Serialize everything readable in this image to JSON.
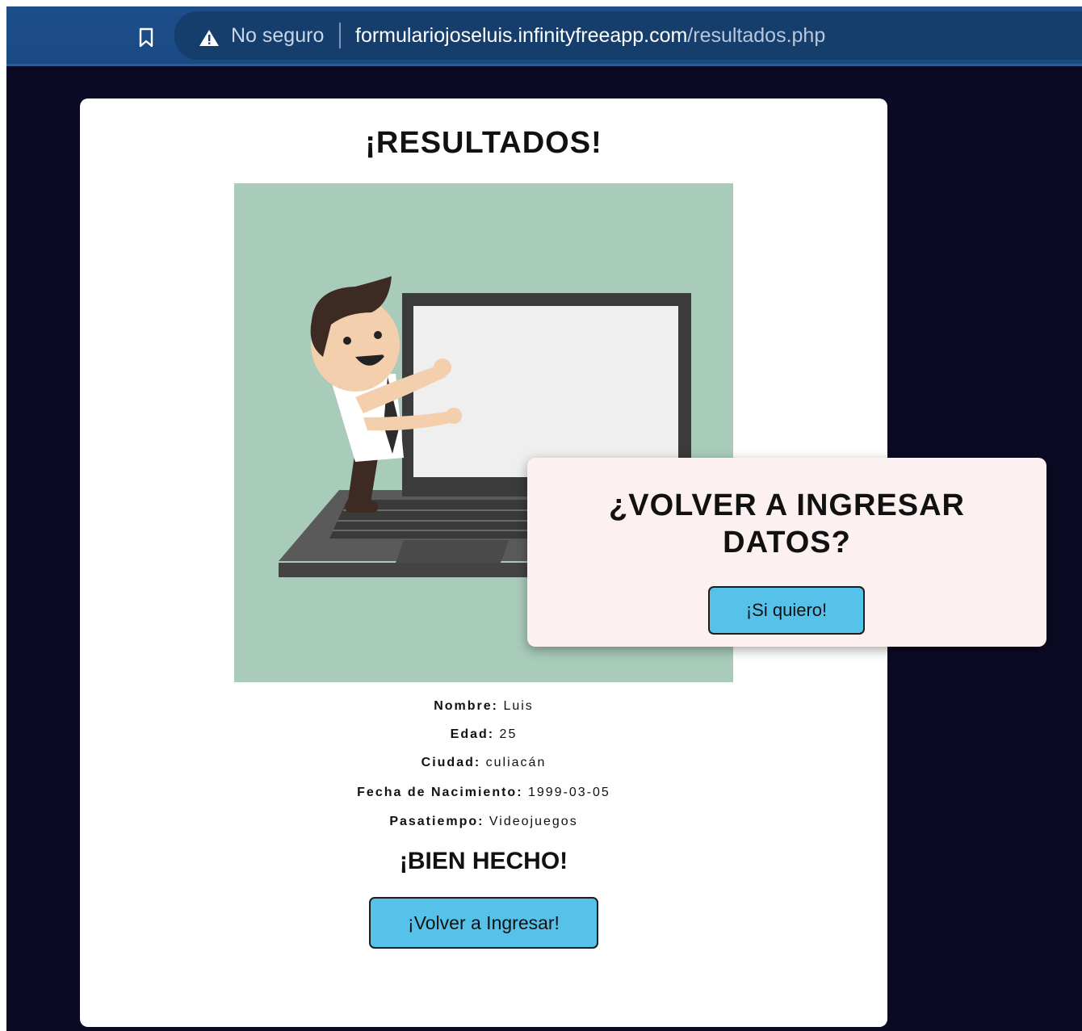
{
  "browser": {
    "security_label": "No seguro",
    "url_domain": "formulariojoseluis.infinityfreeapp.com",
    "url_path": "/resultados.php"
  },
  "page": {
    "title": "¡RESULTADOS!",
    "fields": [
      {
        "label": "Nombre:",
        "value": "Luis"
      },
      {
        "label": "Edad:",
        "value": "25"
      },
      {
        "label": "Ciudad:",
        "value": "culiacán"
      },
      {
        "label": "Fecha de Nacimiento:",
        "value": "1999-03-05"
      },
      {
        "label": "Pasatiempo:",
        "value": "Videojuegos"
      }
    ],
    "done_text": "¡BIEN HECHO!",
    "back_button_label": "¡Volver a Ingresar!"
  },
  "popup": {
    "title_line1": "¿VOLVER A INGRESAR",
    "title_line2": "DATOS?",
    "button_label": "¡Si quiero!"
  },
  "colors": {
    "page_background": "#0b0a24",
    "illustration_background": "#a8cbba",
    "button": "#56c2ea",
    "popup_background": "#fcf0f0",
    "chrome": "#1d4e8a"
  }
}
